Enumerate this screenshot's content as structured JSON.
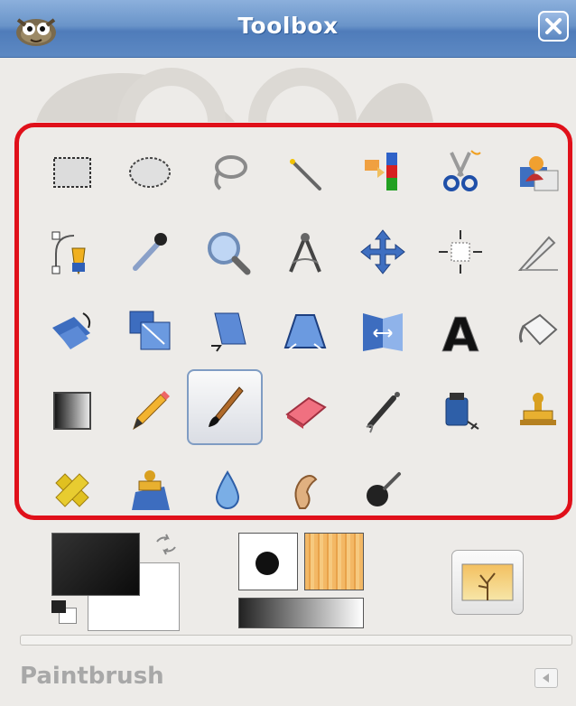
{
  "window": {
    "title": "Toolbox",
    "close_icon": "close-icon",
    "app_icon": "gimp-wilber-icon"
  },
  "tools": [
    {
      "name": "rectangle-select-tool",
      "icon": "rect-select-icon"
    },
    {
      "name": "ellipse-select-tool",
      "icon": "ellipse-select-icon"
    },
    {
      "name": "free-select-tool",
      "icon": "lasso-icon"
    },
    {
      "name": "fuzzy-select-tool",
      "icon": "magic-wand-icon"
    },
    {
      "name": "select-by-color-tool",
      "icon": "color-select-icon"
    },
    {
      "name": "scissors-select-tool",
      "icon": "scissors-icon"
    },
    {
      "name": "foreground-select-tool",
      "icon": "foreground-select-icon"
    },
    {
      "name": "paths-tool",
      "icon": "paths-pen-icon"
    },
    {
      "name": "color-picker-tool",
      "icon": "eyedropper-icon"
    },
    {
      "name": "zoom-tool",
      "icon": "magnifier-icon"
    },
    {
      "name": "measure-tool",
      "icon": "compass-icon"
    },
    {
      "name": "move-tool",
      "icon": "move-arrows-icon"
    },
    {
      "name": "alignment-tool",
      "icon": "align-icon"
    },
    {
      "name": "crop-tool",
      "icon": "crop-knife-icon"
    },
    {
      "name": "rotate-tool",
      "icon": "rotate-icon"
    },
    {
      "name": "scale-tool",
      "icon": "scale-icon"
    },
    {
      "name": "shear-tool",
      "icon": "shear-icon"
    },
    {
      "name": "perspective-tool",
      "icon": "perspective-icon"
    },
    {
      "name": "flip-tool",
      "icon": "flip-icon"
    },
    {
      "name": "text-tool",
      "icon": "text-a-icon"
    },
    {
      "name": "bucket-fill-tool",
      "icon": "bucket-icon"
    },
    {
      "name": "blend-tool",
      "icon": "gradient-icon"
    },
    {
      "name": "pencil-tool",
      "icon": "pencil-icon"
    },
    {
      "name": "paintbrush-tool",
      "icon": "paintbrush-icon",
      "active": true
    },
    {
      "name": "eraser-tool",
      "icon": "eraser-icon"
    },
    {
      "name": "airbrush-tool",
      "icon": "airbrush-icon"
    },
    {
      "name": "ink-tool",
      "icon": "ink-icon"
    },
    {
      "name": "clone-tool",
      "icon": "clone-stamp-icon"
    },
    {
      "name": "heal-tool",
      "icon": "bandage-icon"
    },
    {
      "name": "perspective-clone-tool",
      "icon": "perspective-clone-icon"
    },
    {
      "name": "blur-sharpen-tool",
      "icon": "water-drop-icon"
    },
    {
      "name": "smudge-tool",
      "icon": "smudge-finger-icon"
    },
    {
      "name": "dodge-burn-tool",
      "icon": "dodge-burn-icon"
    }
  ],
  "colors": {
    "foreground": "#111111",
    "background": "#ffffff",
    "swap_icon": "swap-colors-icon",
    "reset_icon": "default-colors-icon"
  },
  "brush": {
    "brush_icon": "round-brush-icon",
    "pattern_icon": "wood-pattern-icon",
    "gradient_icon": "gradient-preview-icon"
  },
  "active_image_icon": "image-thumbnail-icon",
  "status": {
    "tool_name": "Paintbrush",
    "collapse_icon": "triangle-left-icon"
  }
}
